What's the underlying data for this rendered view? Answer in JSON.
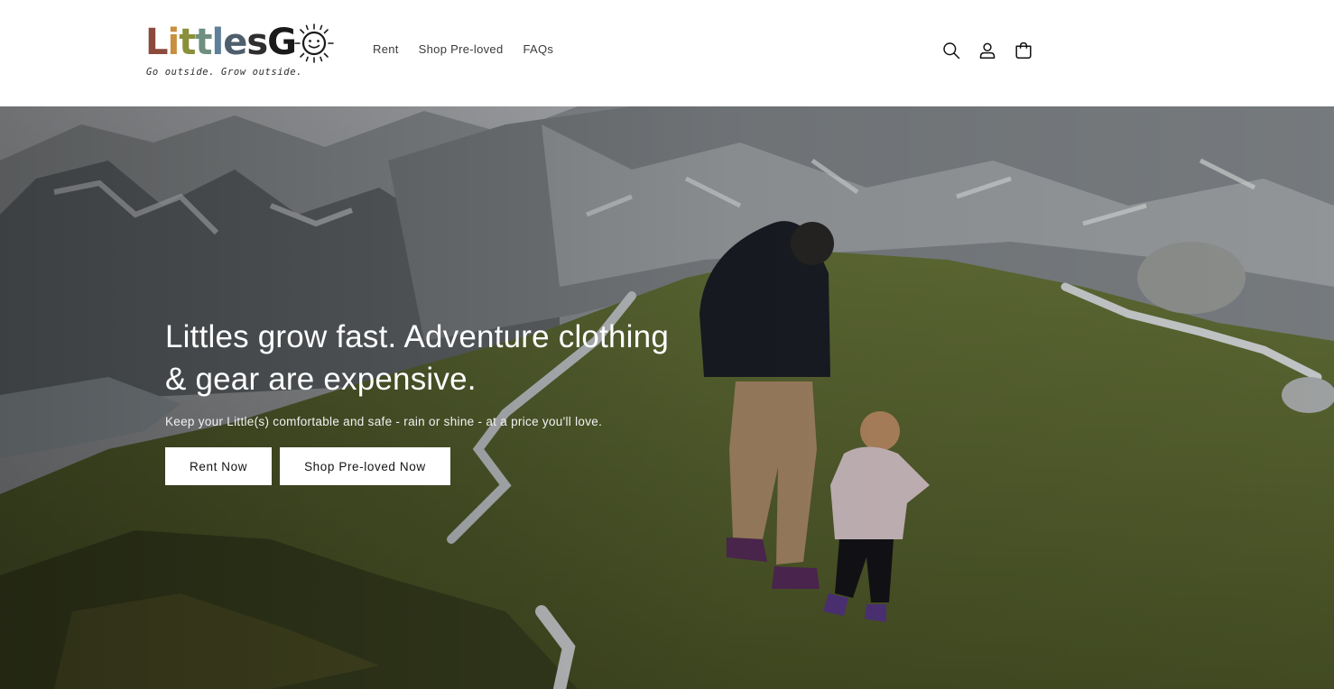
{
  "brand": {
    "name": "LittlesGO",
    "tagline": "Go outside. Grow outside.",
    "letters": [
      {
        "char": "L",
        "color": "#8b4a3c"
      },
      {
        "char": "i",
        "color": "#c98f3e"
      },
      {
        "char": "t",
        "color": "#8a8f3a"
      },
      {
        "char": "t",
        "color": "#6f8f80"
      },
      {
        "char": "l",
        "color": "#5d7f9a"
      },
      {
        "char": "e",
        "color": "#4f5e6d"
      },
      {
        "char": "s",
        "color": "#2f2f2f"
      },
      {
        "char": "G",
        "color": "#1a1a1a"
      }
    ]
  },
  "nav": {
    "items": [
      {
        "label": "Rent"
      },
      {
        "label": "Shop Pre-loved"
      },
      {
        "label": "FAQs"
      }
    ]
  },
  "header_icons": [
    "search-icon",
    "account-icon",
    "cart-icon"
  ],
  "hero": {
    "heading": "Littles grow fast. Adventure clothing & gear are expensive.",
    "subheading": "Keep your Little(s) comfortable and safe - rain or shine - at a price you'll love.",
    "primary_button": "Rent Now",
    "secondary_button": "Shop Pre-loved Now"
  }
}
